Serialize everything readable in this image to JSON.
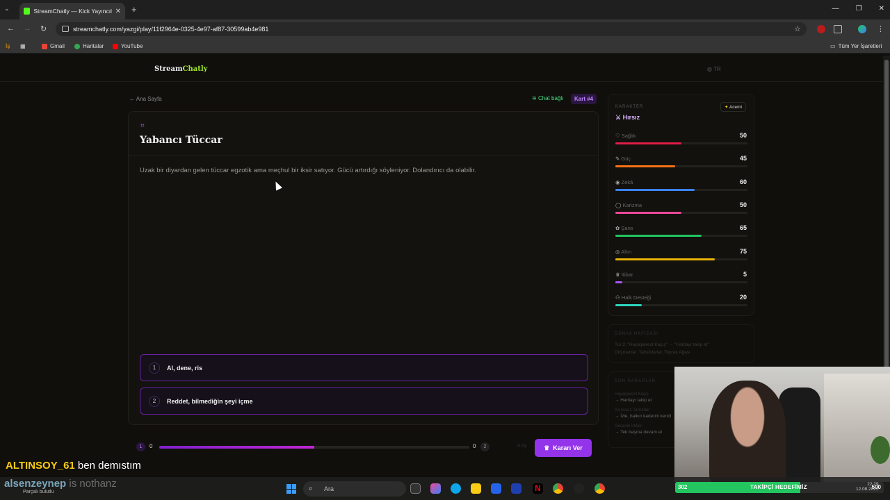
{
  "browser": {
    "tab_title": "StreamChatly — Kick Yayıncıları",
    "url": "streamchatly.com/yazgi/play/11f2964e-0325-4e97-af87-30599ab4e981",
    "bookmarks": [
      {
        "label": "İş",
        "icon": "work-icon"
      },
      {
        "label": "Gmail",
        "icon": "gmail-icon"
      },
      {
        "label": "Haritalar",
        "icon": "maps-icon"
      },
      {
        "label": "YouTube",
        "icon": "youtube-icon"
      }
    ],
    "all_bookmarks": "Tüm Yer İşaretleri"
  },
  "app": {
    "logo_a": "Stream",
    "logo_b": "Chatly",
    "lang": "TR",
    "back_label": "Ana Sayfa",
    "chat_status": "Chat bağlı",
    "card_badge": "Kart #4"
  },
  "card": {
    "title": "Yabancı Tüccar",
    "description": "Uzak bir diyardan gelen tüccar egzotik ama meçhul bir iksir satıyor. Gücü artırdığı söyleniyor. Dolandırıcı da olabilir.",
    "options": [
      {
        "num": "1",
        "label": "Al, dene, ris"
      },
      {
        "num": "2",
        "label": "Reddet, bilmediğin şeyi içme"
      }
    ]
  },
  "vote": {
    "left_badge": "1",
    "left_count": "0",
    "right_count": "0",
    "right_badge": "2",
    "fill_fraction": 0.5,
    "votes_label": "0 oy",
    "submit_label": "Kararı Ver"
  },
  "character": {
    "header": "KARAKTER",
    "level": "Acemi",
    "class_name": "Hırsız",
    "stats": [
      {
        "name": "Sağlık",
        "value": 50,
        "color": "#e11d48",
        "icon": "heart-icon"
      },
      {
        "name": "Güç",
        "value": 45,
        "color": "#f97316",
        "icon": "sword-icon"
      },
      {
        "name": "Zekâ",
        "value": 60,
        "color": "#3b82f6",
        "icon": "brain-icon"
      },
      {
        "name": "Karizma",
        "value": 50,
        "color": "#ec4899",
        "icon": "speech-icon"
      },
      {
        "name": "Şans",
        "value": 65,
        "color": "#22c55e",
        "icon": "clover-icon"
      },
      {
        "name": "Altın",
        "value": 75,
        "color": "#eab308",
        "icon": "coin-icon"
      },
      {
        "name": "İtibar",
        "value": 5,
        "color": "#a855f7",
        "icon": "crown-icon"
      },
      {
        "name": "Halk Desteği",
        "value": 20,
        "color": "#2dd4bf",
        "icon": "people-icon"
      }
    ]
  },
  "world_memory": {
    "header": "DÜNYA HAFIZASI",
    "line1": "Tur 2: \"Hayalperest Kaçış\" → \"Haritayı takip et\"",
    "line2": "Düşmanlar: Tahsildarlar, Toprak Ağası"
  },
  "last_decisions": {
    "header": "SON KARARLAR",
    "items": [
      {
        "title": "Hayalperest Kaçış",
        "choice": "→ Haritayı takip et"
      },
      {
        "title": "Acımasız Tahsildar",
        "choice": "→ İzle, halkın kaderini kendi"
      },
      {
        "title": "Gecenin İttifakı",
        "choice": "→ Tek başına devam et"
      }
    ]
  },
  "stream_overlay": {
    "chat_user": "ALTINSOY_61",
    "chat_message": "ben demıstım",
    "chat_user2": "alsenzeynep",
    "chat_message2": "is nothanz",
    "goal_left": "302",
    "goal_label": "TAKİPÇİ HEDEFİMİZ",
    "goal_right": "500",
    "goal_fraction": 0.6
  },
  "taskbar": {
    "weather": "Parçalı bulutlu",
    "search_placeholder": "Ara",
    "time": "22:29",
    "date": "12.08.2025"
  }
}
